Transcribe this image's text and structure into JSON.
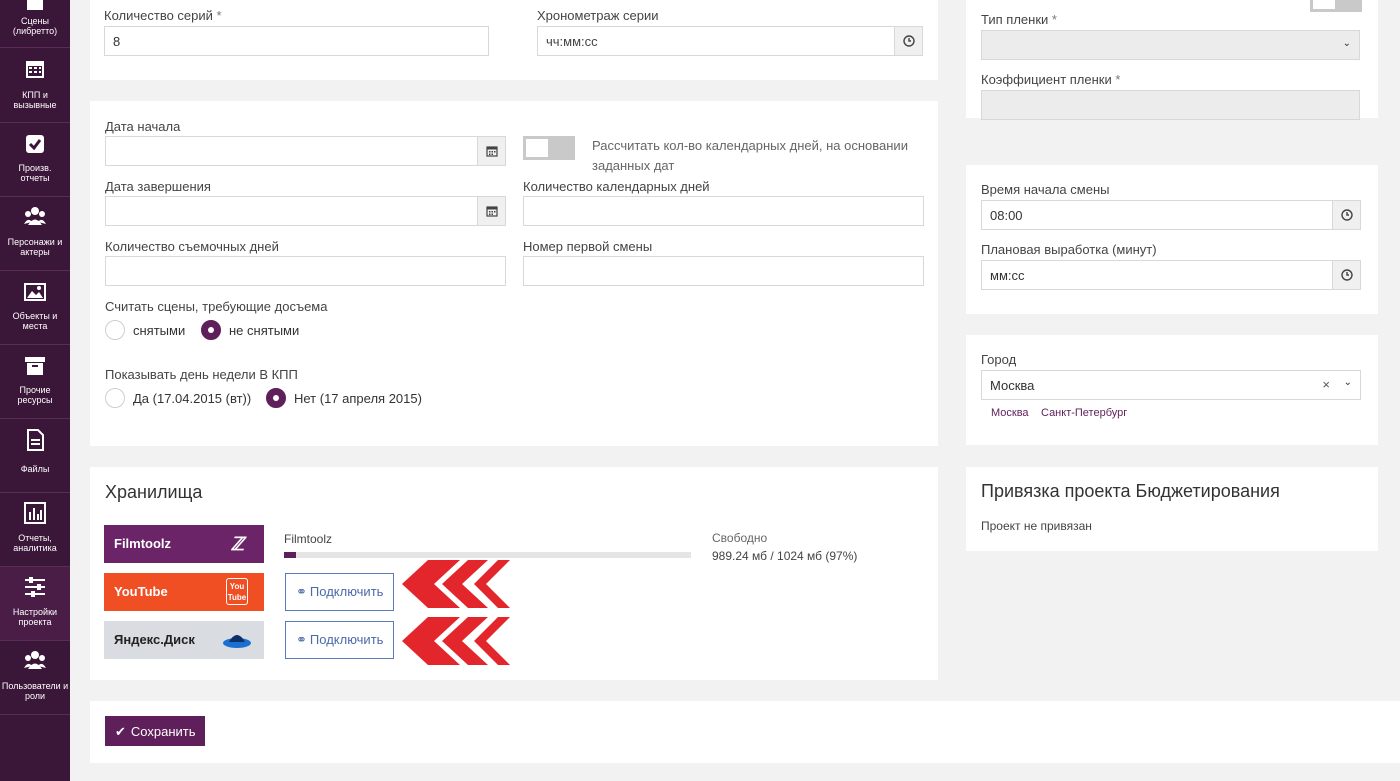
{
  "sidebar": {
    "items": [
      {
        "label_1": "Сцены",
        "label_2": "(либретто)",
        "icon": "book-icon"
      },
      {
        "label_1": "КПП и",
        "label_2": "вызывные",
        "icon": "calendar-icon"
      },
      {
        "label_1": "Произв.",
        "label_2": "отчеты",
        "icon": "check-icon"
      },
      {
        "label_1": "Персонажи и",
        "label_2": "актеры",
        "icon": "users-icon"
      },
      {
        "label_1": "Объекты и",
        "label_2": "места",
        "icon": "image-icon"
      },
      {
        "label_1": "Прочие",
        "label_2": "ресурсы",
        "icon": "archive-icon"
      },
      {
        "label_1": "Файлы",
        "label_2": "",
        "icon": "file-icon"
      },
      {
        "label_1": "Отчеты,",
        "label_2": "аналитика",
        "icon": "bar-chart-icon"
      },
      {
        "label_1": "Настройки",
        "label_2": "проекта",
        "icon": "sliders-icon"
      },
      {
        "label_1": "Пользователи и",
        "label_2": "роли",
        "icon": "users-icon"
      }
    ]
  },
  "series": {
    "count_label": "Количество серий",
    "count_value": "8",
    "duration_label": "Хронометраж серии",
    "duration_placeholder": "чч:мм:сс",
    "required_mark": "*"
  },
  "dates": {
    "start_label": "Дата начала",
    "start_value": "",
    "calc_toggle_label_1": "Рассчитать кол-во календарных дней, на основании",
    "calc_toggle_label_2": "заданных дат",
    "end_label": "Дата завершения",
    "end_value": "",
    "calendar_days_label": "Количество календарных дней",
    "calendar_days_value": "",
    "shooting_days_label": "Количество съемочных дней",
    "shooting_days_value": "",
    "first_shift_label": "Номер первой смены",
    "first_shift_value": "",
    "reshoot_label": "Считать сцены, требующие досъема",
    "reshoot_opt_1": "снятыми",
    "reshoot_opt_2": "не снятыми",
    "weekday_label": "Показывать день недели В КПП",
    "weekday_opt_1": "Да (17.04.2015 (вт))",
    "weekday_opt_2": "Нет (17 апреля 2015)"
  },
  "film": {
    "type_label": "Тип пленки",
    "type_value": "",
    "coef_label": "Коэффициент пленки",
    "coef_value": ""
  },
  "shift": {
    "start_label": "Время начала смены",
    "start_value": "08:00",
    "output_label": "Плановая выработка (минут)",
    "output_placeholder": "мм:сс"
  },
  "city": {
    "label": "Город",
    "value": "Москва",
    "clear": "×",
    "chips": [
      "Москва",
      "Санкт-Петербург"
    ]
  },
  "storage": {
    "title": "Хранилища",
    "providers": [
      {
        "name": "Filmtoolz",
        "color": "#6b2467"
      },
      {
        "name": "YouTube",
        "color": "#f04e23"
      },
      {
        "name": "Яндекс.Диск",
        "color": "#d9dce0"
      }
    ],
    "filmtoolz_name": "Filmtoolz",
    "progress_fraction": 0.03,
    "free_label": "Свободно",
    "free_value": "989.24 мб / 1024 мб (97%)",
    "connect_label": "Подключить"
  },
  "budget": {
    "title": "Привязка проекта Бюджетирования",
    "status": "Проект не привязан"
  },
  "actions": {
    "save_label": "Сохранить"
  },
  "colors": {
    "accent": "#5e1f5a",
    "sidebar": "#3a1638",
    "annotation_arrows": "#e3262b"
  }
}
